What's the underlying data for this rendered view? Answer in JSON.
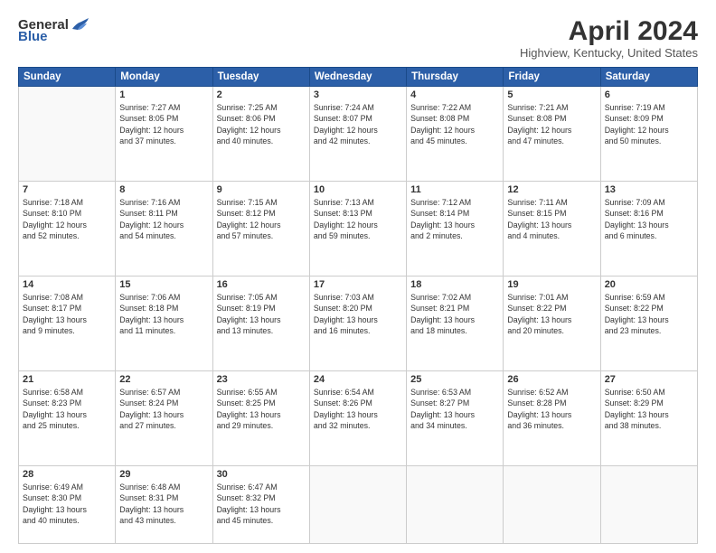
{
  "header": {
    "logo_general": "General",
    "logo_blue": "Blue",
    "title": "April 2024",
    "location": "Highview, Kentucky, United States"
  },
  "days_of_week": [
    "Sunday",
    "Monday",
    "Tuesday",
    "Wednesday",
    "Thursday",
    "Friday",
    "Saturday"
  ],
  "weeks": [
    [
      {
        "num": "",
        "info": ""
      },
      {
        "num": "1",
        "info": "Sunrise: 7:27 AM\nSunset: 8:05 PM\nDaylight: 12 hours\nand 37 minutes."
      },
      {
        "num": "2",
        "info": "Sunrise: 7:25 AM\nSunset: 8:06 PM\nDaylight: 12 hours\nand 40 minutes."
      },
      {
        "num": "3",
        "info": "Sunrise: 7:24 AM\nSunset: 8:07 PM\nDaylight: 12 hours\nand 42 minutes."
      },
      {
        "num": "4",
        "info": "Sunrise: 7:22 AM\nSunset: 8:08 PM\nDaylight: 12 hours\nand 45 minutes."
      },
      {
        "num": "5",
        "info": "Sunrise: 7:21 AM\nSunset: 8:08 PM\nDaylight: 12 hours\nand 47 minutes."
      },
      {
        "num": "6",
        "info": "Sunrise: 7:19 AM\nSunset: 8:09 PM\nDaylight: 12 hours\nand 50 minutes."
      }
    ],
    [
      {
        "num": "7",
        "info": "Sunrise: 7:18 AM\nSunset: 8:10 PM\nDaylight: 12 hours\nand 52 minutes."
      },
      {
        "num": "8",
        "info": "Sunrise: 7:16 AM\nSunset: 8:11 PM\nDaylight: 12 hours\nand 54 minutes."
      },
      {
        "num": "9",
        "info": "Sunrise: 7:15 AM\nSunset: 8:12 PM\nDaylight: 12 hours\nand 57 minutes."
      },
      {
        "num": "10",
        "info": "Sunrise: 7:13 AM\nSunset: 8:13 PM\nDaylight: 12 hours\nand 59 minutes."
      },
      {
        "num": "11",
        "info": "Sunrise: 7:12 AM\nSunset: 8:14 PM\nDaylight: 13 hours\nand 2 minutes."
      },
      {
        "num": "12",
        "info": "Sunrise: 7:11 AM\nSunset: 8:15 PM\nDaylight: 13 hours\nand 4 minutes."
      },
      {
        "num": "13",
        "info": "Sunrise: 7:09 AM\nSunset: 8:16 PM\nDaylight: 13 hours\nand 6 minutes."
      }
    ],
    [
      {
        "num": "14",
        "info": "Sunrise: 7:08 AM\nSunset: 8:17 PM\nDaylight: 13 hours\nand 9 minutes."
      },
      {
        "num": "15",
        "info": "Sunrise: 7:06 AM\nSunset: 8:18 PM\nDaylight: 13 hours\nand 11 minutes."
      },
      {
        "num": "16",
        "info": "Sunrise: 7:05 AM\nSunset: 8:19 PM\nDaylight: 13 hours\nand 13 minutes."
      },
      {
        "num": "17",
        "info": "Sunrise: 7:03 AM\nSunset: 8:20 PM\nDaylight: 13 hours\nand 16 minutes."
      },
      {
        "num": "18",
        "info": "Sunrise: 7:02 AM\nSunset: 8:21 PM\nDaylight: 13 hours\nand 18 minutes."
      },
      {
        "num": "19",
        "info": "Sunrise: 7:01 AM\nSunset: 8:22 PM\nDaylight: 13 hours\nand 20 minutes."
      },
      {
        "num": "20",
        "info": "Sunrise: 6:59 AM\nSunset: 8:22 PM\nDaylight: 13 hours\nand 23 minutes."
      }
    ],
    [
      {
        "num": "21",
        "info": "Sunrise: 6:58 AM\nSunset: 8:23 PM\nDaylight: 13 hours\nand 25 minutes."
      },
      {
        "num": "22",
        "info": "Sunrise: 6:57 AM\nSunset: 8:24 PM\nDaylight: 13 hours\nand 27 minutes."
      },
      {
        "num": "23",
        "info": "Sunrise: 6:55 AM\nSunset: 8:25 PM\nDaylight: 13 hours\nand 29 minutes."
      },
      {
        "num": "24",
        "info": "Sunrise: 6:54 AM\nSunset: 8:26 PM\nDaylight: 13 hours\nand 32 minutes."
      },
      {
        "num": "25",
        "info": "Sunrise: 6:53 AM\nSunset: 8:27 PM\nDaylight: 13 hours\nand 34 minutes."
      },
      {
        "num": "26",
        "info": "Sunrise: 6:52 AM\nSunset: 8:28 PM\nDaylight: 13 hours\nand 36 minutes."
      },
      {
        "num": "27",
        "info": "Sunrise: 6:50 AM\nSunset: 8:29 PM\nDaylight: 13 hours\nand 38 minutes."
      }
    ],
    [
      {
        "num": "28",
        "info": "Sunrise: 6:49 AM\nSunset: 8:30 PM\nDaylight: 13 hours\nand 40 minutes."
      },
      {
        "num": "29",
        "info": "Sunrise: 6:48 AM\nSunset: 8:31 PM\nDaylight: 13 hours\nand 43 minutes."
      },
      {
        "num": "30",
        "info": "Sunrise: 6:47 AM\nSunset: 8:32 PM\nDaylight: 13 hours\nand 45 minutes."
      },
      {
        "num": "",
        "info": ""
      },
      {
        "num": "",
        "info": ""
      },
      {
        "num": "",
        "info": ""
      },
      {
        "num": "",
        "info": ""
      }
    ]
  ]
}
